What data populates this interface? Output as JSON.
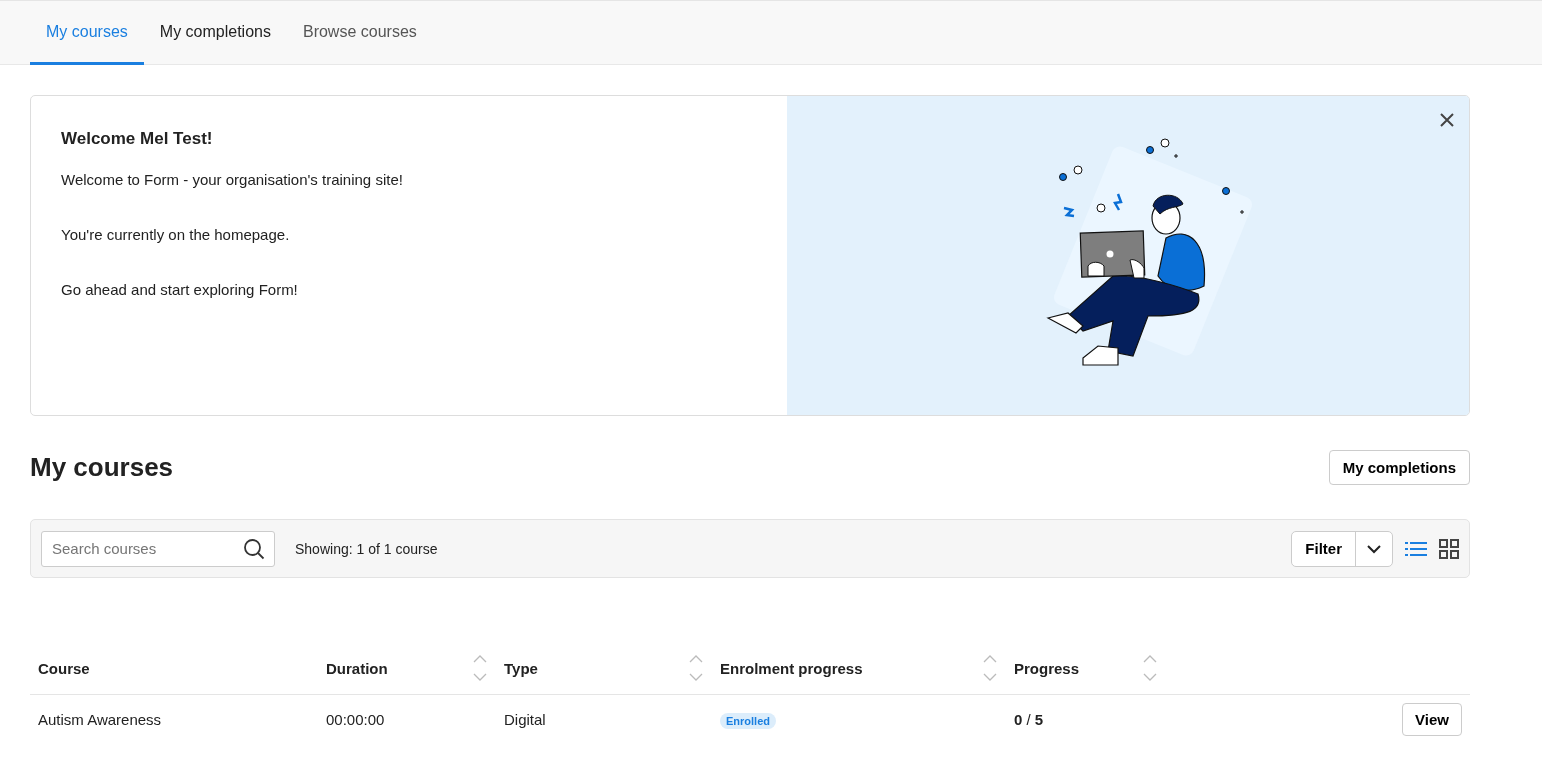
{
  "tabs": [
    {
      "label": "My courses",
      "selected": true
    },
    {
      "label": "My completions",
      "selected": false
    },
    {
      "label": "Browse courses",
      "selected": false
    }
  ],
  "banner": {
    "title": "Welcome Mel Test!",
    "paragraphs": [
      "Welcome to Form - your organisation's training site!",
      "You're currently on the homepage.",
      "Go ahead and start exploring Form!"
    ]
  },
  "section": {
    "title": "My courses",
    "button": "My completions"
  },
  "toolbar": {
    "search": {
      "placeholder": "Search courses"
    },
    "showing": "Showing: 1 of 1 course",
    "filter": "Filter",
    "view_modes": [
      {
        "kind": "list",
        "selected": true
      },
      {
        "kind": "grid",
        "selected": false
      }
    ]
  },
  "table": {
    "columns": [
      {
        "label": "Course",
        "sortable": false
      },
      {
        "label": "Duration",
        "sortable": true
      },
      {
        "label": "Type",
        "sortable": true
      },
      {
        "label": "Enrolment progress",
        "sortable": true
      },
      {
        "label": "Progress",
        "sortable": true
      }
    ],
    "rows": [
      {
        "course": "Autism Awareness",
        "duration": "00:00:00",
        "type": "Digital",
        "enrolment": "Enrolled",
        "progress": "**0** / **5**",
        "action": "View"
      }
    ]
  }
}
